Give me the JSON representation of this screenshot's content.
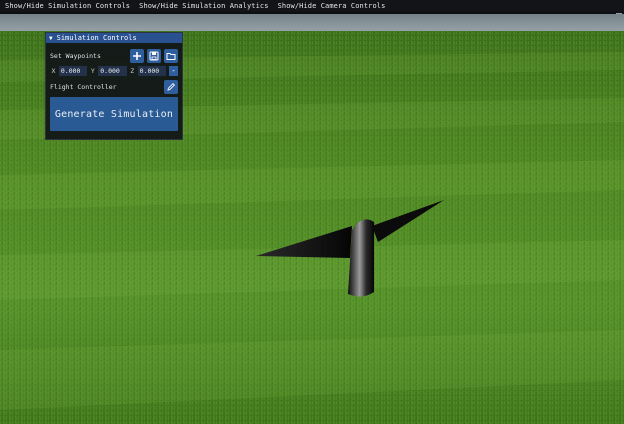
{
  "menubar": {
    "items": [
      "Show/Hide Simulation Controls",
      "Show/Hide Simulation Analytics",
      "Show/Hide Camera Controls"
    ]
  },
  "panel": {
    "title": "Simulation Controls",
    "waypoints_label": "Set Waypoints",
    "x_label": "X",
    "x_value": "0.000",
    "y_label": "Y",
    "y_value": "0.000",
    "z_label": "Z",
    "z_value": "0.000",
    "remove_label": "-",
    "flight_controller_label": "Flight Controller",
    "generate_label": "Generate Simulation"
  },
  "icons": {
    "add": "plus-icon",
    "save": "save-icon",
    "open": "folder-icon",
    "edit": "pencil-icon",
    "collapse": "triangle-down-icon"
  },
  "colors": {
    "menubar_bg": "#121417",
    "panel_bg": "#101217",
    "title_bar": "#295190",
    "button": "#2e5e9e",
    "grass": "#4d8220"
  }
}
